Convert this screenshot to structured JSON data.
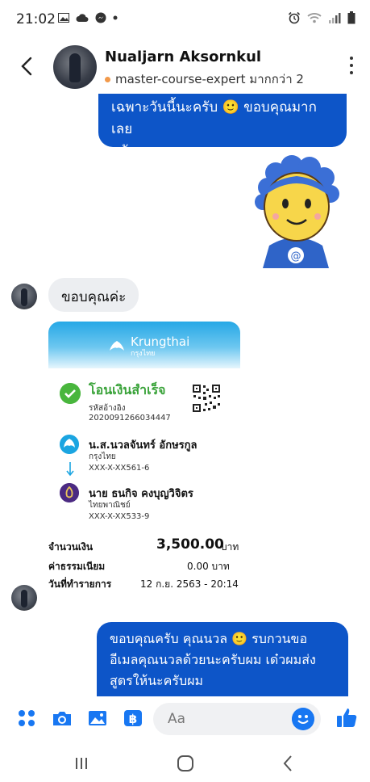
{
  "status_bar": {
    "time": "21:02"
  },
  "header": {
    "contact_name": "Nualjarn Aksornkul",
    "subtitle": "master-course-expert มากกว่า 2"
  },
  "messages": {
    "outgoing_top": [
      "เฉพาะวันนี้นะครับ 🙂 ขอบคุณมากเลย",
      "ครับ"
    ],
    "incoming_thanks": "ขอบคุณค่ะ",
    "outgoing_bottom": [
      "ขอบคุณครับ คุณนวล 🙂 รบกวนขอ",
      "อีเมลคุณนวลด้วยนะครับผม เด๋วผมส่ง",
      "สูตรให้นะครับผม"
    ]
  },
  "slip": {
    "brand": "Krungthai",
    "brand_thai": "กรุงไทย",
    "title": "โอนเงินสำเร็จ",
    "ref_label": "รหัสอ้างอิง",
    "ref_no": "2020091266034447",
    "sender_name": "น.ส.นวลจันทร์ อักษรกูล",
    "sender_bank": "กรุงไทย",
    "sender_acct": "XXX-X-XX561-6",
    "receiver_name": "นาย ธนกิจ คงบุญวิจิตร",
    "receiver_bank": "ไทยพาณิชย์",
    "receiver_acct": "XXX-X-XX533-9",
    "amount_label": "จำนวนเงิน",
    "amount": "3,500.00",
    "amount_unit": "บาท",
    "fee_label": "ค่าธรรมเนียม",
    "fee": "0.00 บาท",
    "date_label": "วันที่ทำรายการ",
    "date": "12 ก.ย. 2563 - 20:14"
  },
  "composer": {
    "placeholder": "Aa"
  },
  "colors": {
    "accent": "#0d55c8",
    "messenger_blue": "#1877f2",
    "success_green": "#49b63d",
    "krungthai_blue": "#1ba5e1",
    "scb_purple": "#4b2a82"
  },
  "icons": {
    "status_left": [
      "gallery-icon",
      "cloud-icon",
      "messenger-icon",
      "dot-icon"
    ],
    "status_right": [
      "alarm-icon",
      "wifi-icon",
      "signal-icon",
      "battery-icon"
    ],
    "composer": [
      "apps-grid-icon",
      "camera-icon",
      "image-icon",
      "baht-pay-icon",
      "emoji-icon",
      "thumbs-up-icon"
    ],
    "nav": [
      "recent-apps-icon",
      "home-icon",
      "back-icon"
    ]
  }
}
